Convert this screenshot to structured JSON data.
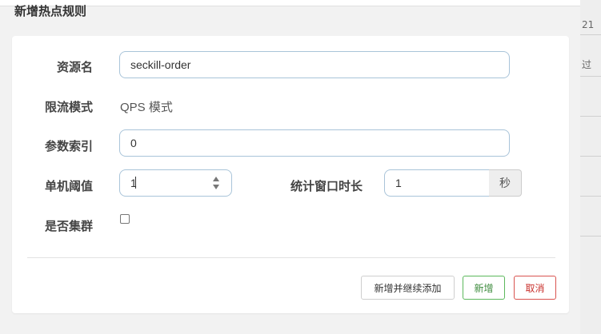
{
  "dialog": {
    "title": "新增热点规则"
  },
  "background": {
    "peek_top": "21",
    "peek_mid": "过"
  },
  "form": {
    "resource": {
      "label": "资源名",
      "value": "seckill-order"
    },
    "mode": {
      "label": "限流模式",
      "value": "QPS 模式"
    },
    "param_index": {
      "label": "参数索引",
      "value": "0"
    },
    "threshold": {
      "label": "单机阈值",
      "value": "1"
    },
    "window": {
      "label": "统计窗口时长",
      "value": "1",
      "unit": "秒"
    },
    "cluster": {
      "label": "是否集群",
      "checked": false
    }
  },
  "buttons": {
    "add_continue": "新增并继续添加",
    "add": "新增",
    "cancel": "取消"
  },
  "colors": {
    "success": "#5cb85c",
    "danger": "#d9534f",
    "input_border": "#a9c4d9"
  },
  "icons": {
    "spinner": "updown-arrows-icon"
  }
}
